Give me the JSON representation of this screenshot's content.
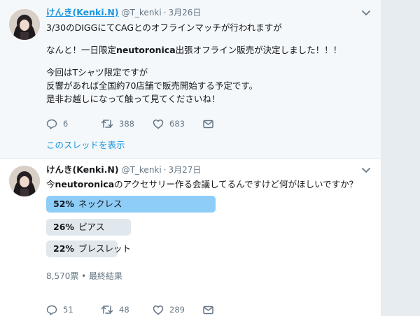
{
  "tweets": [
    {
      "fullname": "けんき(Kenki.N)",
      "handle": "@T_kenki",
      "separator": "·",
      "date": "3月26日",
      "lines": [
        "3/30のDIGGにてCAGとのオフラインマッチが行われますが",
        "",
        {
          "pre": "なんと！一日限定",
          "bold": "neutoronica",
          "post": "出張オフライン販売が決定しました！！！"
        },
        "",
        "今回はTシャツ限定ですが",
        "反響があれば全国約70店舗で販売開始する予定です。",
        "是非お越しになって触って見てくださいね！"
      ],
      "actions": {
        "reply": "6",
        "retweet": "388",
        "like": "683"
      },
      "thread_link": "このスレッドを表示"
    },
    {
      "fullname": "けんき(Kenki.N)",
      "handle": "@T_kenki",
      "separator": "·",
      "date": "3月27日",
      "text": {
        "pre": "今",
        "bold": "neutoronica",
        "post": "のアクセサリー作る会議してるんですけど何がほしいですか？"
      },
      "poll": {
        "choices": [
          {
            "percent": "52%",
            "label": "ネックレス",
            "fraction": 0.52,
            "winner": true
          },
          {
            "percent": "26%",
            "label": "ピアス",
            "fraction": 0.26,
            "winner": false
          },
          {
            "percent": "22%",
            "label": "ブレスレット",
            "fraction": 0.22,
            "winner": false
          }
        ],
        "meta": "8,570票 • 最終結果"
      },
      "actions": {
        "reply": "51",
        "retweet": "48",
        "like": "289"
      }
    }
  ],
  "colors": {
    "link": "#1b95e0",
    "winner_bar": "#8ecdf8",
    "bar": "#e1e8ed",
    "muted": "#657786"
  },
  "icons": [
    "reply-icon",
    "retweet-icon",
    "like-icon",
    "direct-message-icon",
    "chevron-down-icon"
  ]
}
